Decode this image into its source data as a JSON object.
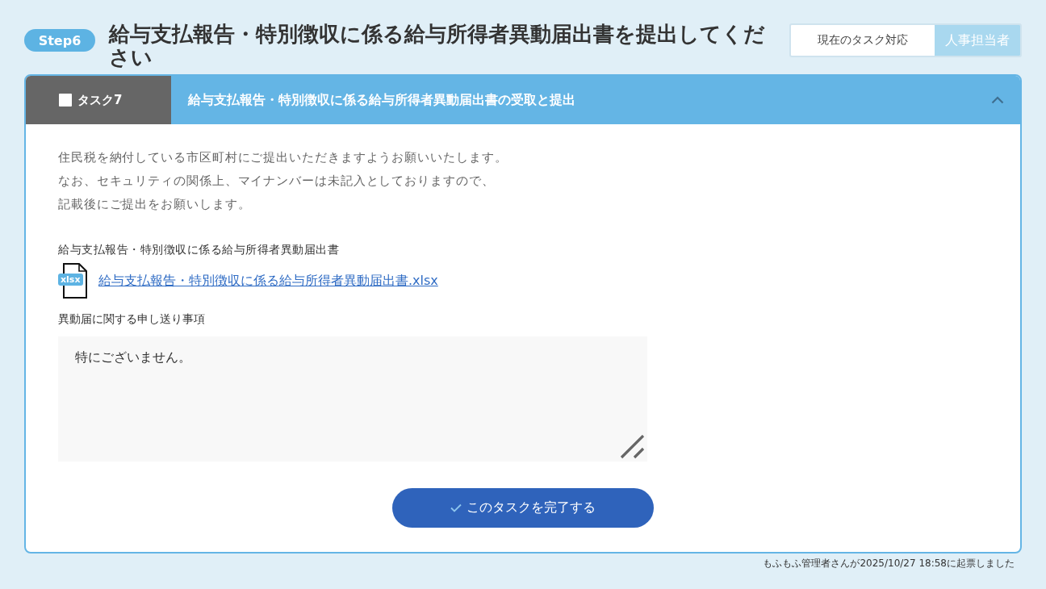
{
  "step": {
    "label": "Step6"
  },
  "title": "給与支払報告・特別徴収に係る給与所得者異動届出書を提出してください",
  "assignment": {
    "label": "現在のタスク対応",
    "assignee": "人事担当者"
  },
  "task": {
    "checked": false,
    "label": "タスク7",
    "title": "給与支払報告・特別徴収に係る給与所得者異動届出書の受取と提出",
    "expanded": true,
    "description": [
      "住民税を納付している市区町村にご提出いただきますようお願いいたします。",
      "なお、セキュリティの関係上、マイナンバーは未記入としておりますので、",
      "記載後にご提出をお願いします。"
    ],
    "attachment": {
      "label": "給与支払報告・特別徴収に係る給与所得者異動届出書",
      "file_badge": "xlsx",
      "file_name": "給与支払報告・特別徴収に係る給与所得者異動届出書.xlsx"
    },
    "notes": {
      "label": "異動届に関する申し送り事項",
      "value": "特にございません。"
    },
    "complete_button": "このタスクを完了する"
  },
  "footer": "もふもふ管理者さんが2025/10/27 18:58に起票しました"
}
